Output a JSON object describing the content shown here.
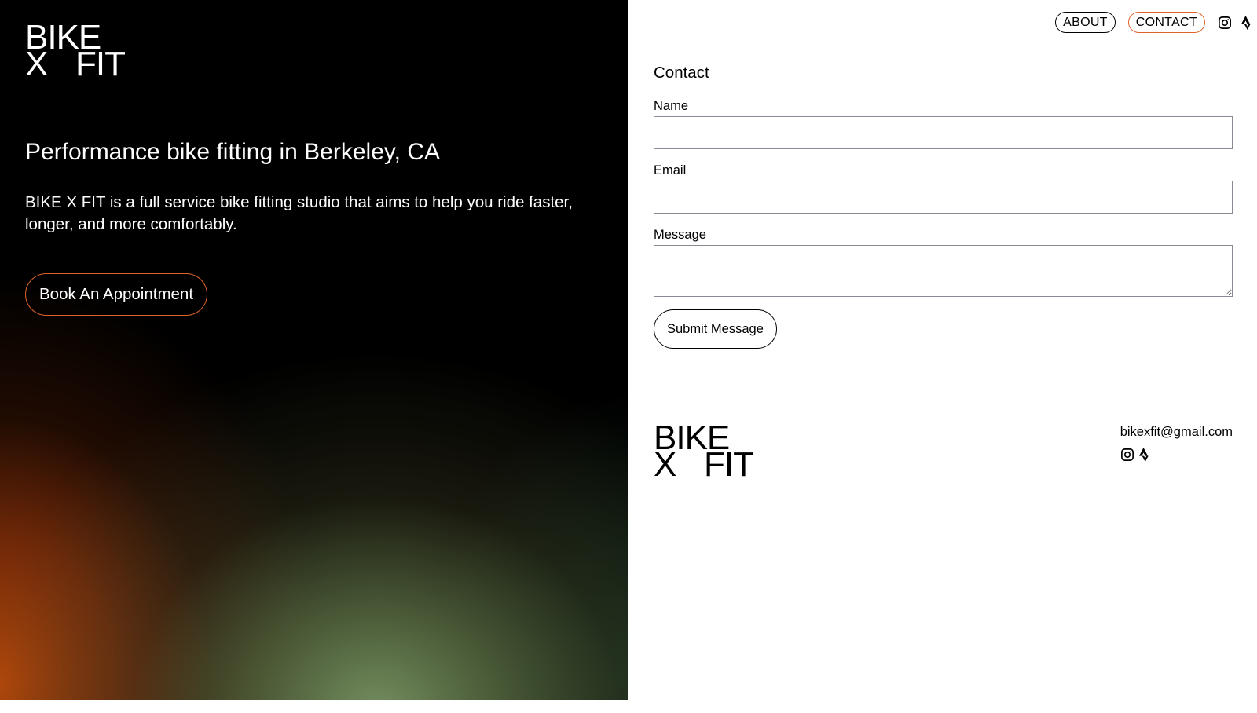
{
  "brand": {
    "logo_line1": "BIKE",
    "logo_line2_left": "X",
    "logo_line2_right": "FIT"
  },
  "hero": {
    "title": "Performance bike fitting in Berkeley, CA",
    "description": "BIKE X FIT is a full service bike fitting studio that aims to help you ride faster, longer, and more comfortably.",
    "cta_label": "Book An Appointment"
  },
  "nav": {
    "items": [
      {
        "label": "ABOUT"
      },
      {
        "label": "CONTACT"
      }
    ],
    "icons": [
      "instagram-icon",
      "strava-icon"
    ]
  },
  "contact_form": {
    "title": "Contact",
    "name_label": "Name",
    "name_value": "",
    "email_label": "Email",
    "email_value": "",
    "message_label": "Message",
    "message_value": "",
    "submit_label": "Submit Message"
  },
  "footer": {
    "email": "bikexfit@gmail.com",
    "icons": [
      "instagram-icon",
      "strava-icon"
    ]
  },
  "colors": {
    "accent": "#e0632a",
    "hero_background": "#000000",
    "panel_background": "#ffffff",
    "input_border": "#8a8a94"
  }
}
